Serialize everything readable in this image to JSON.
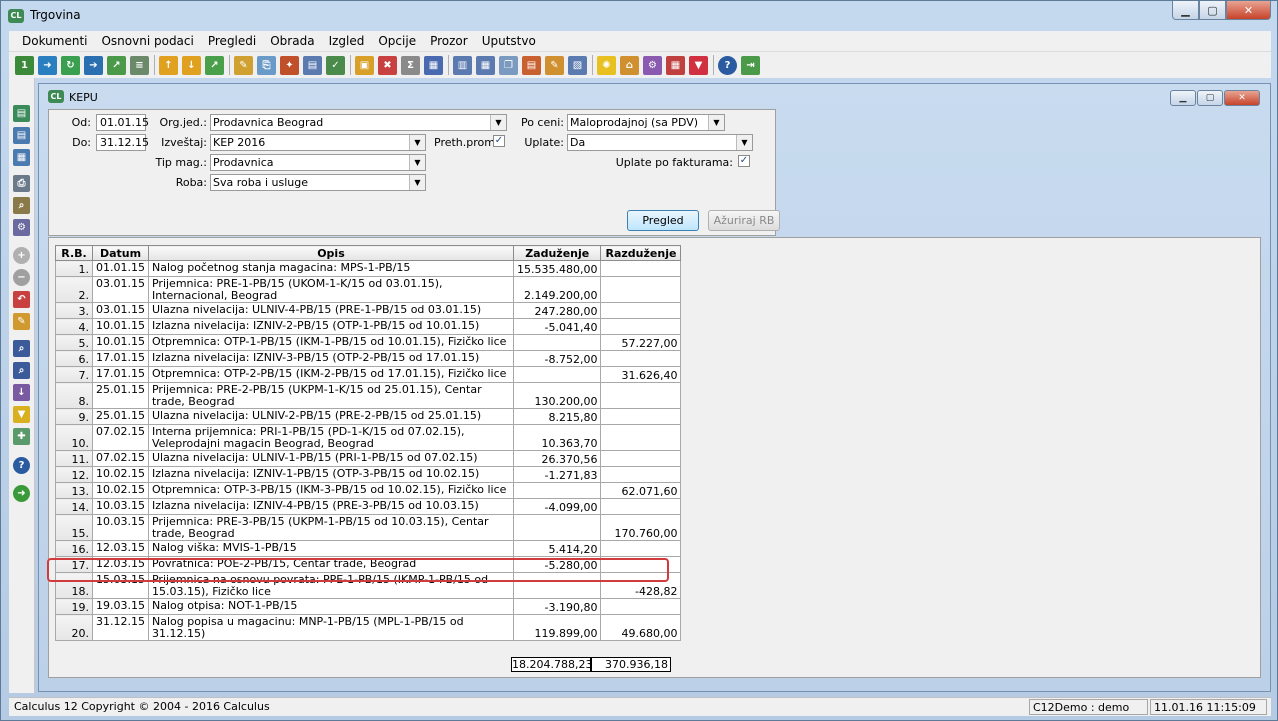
{
  "window": {
    "title": "Trgovina",
    "icon_text": "CL"
  },
  "menu": [
    "Dokumenti",
    "Osnovni podaci",
    "Pregledi",
    "Obrada",
    "Izgled",
    "Opcije",
    "Prozor",
    "Uputstvo"
  ],
  "child_window": {
    "title": "KEPU"
  },
  "filters": {
    "od_label": "Od:",
    "od_value": "01.01.15",
    "do_label": "Do:",
    "do_value": "31.12.15",
    "orgjed_label": "Org.jed.:",
    "orgjed_value": "Prodavnica Beograd",
    "izvestaj_label": "Izveštaj:",
    "izvestaj_value": "KEP 2016",
    "tipmag_label": "Tip mag.:",
    "tipmag_value": "Prodavnica",
    "roba_label": "Roba:",
    "roba_value": "Sva roba i usluge",
    "prethprom_label": "Preth.prom",
    "prethprom_checked": true,
    "poceni_label": "Po ceni:",
    "poceni_value": "Maloprodajnoj (sa PDV)",
    "uplate_label": "Uplate:",
    "uplate_value": "Da",
    "uplatepofak_label": "Uplate po fakturama:",
    "uplatepofak_checked": true,
    "pregled_button": "Pregled",
    "azuriraj_button": "Ažuriraj RB"
  },
  "table": {
    "columns": [
      "R.B.",
      "Datum",
      "Opis",
      "Zaduženje",
      "Razduženje"
    ],
    "rows": [
      {
        "rb": "1.",
        "datum": "01.01.15",
        "opis": "Nalog početnog stanja magacina: MPS-1-PB/15",
        "zad": "15.535.480,00",
        "raz": ""
      },
      {
        "rb": "2.",
        "datum": "03.01.15",
        "opis": "Prijemnica: PRE-1-PB/15 (UKOM-1-K/15 od 03.01.15), Internacional, Beograd",
        "zad": "2.149.200,00",
        "raz": ""
      },
      {
        "rb": "3.",
        "datum": "03.01.15",
        "opis": "Ulazna nivelacija: ULNIV-4-PB/15 (PRE-1-PB/15 od 03.01.15)",
        "zad": "247.280,00",
        "raz": ""
      },
      {
        "rb": "4.",
        "datum": "10.01.15",
        "opis": "Izlazna nivelacija: IZNIV-2-PB/15 (OTP-1-PB/15 od 10.01.15)",
        "zad": "-5.041,40",
        "raz": ""
      },
      {
        "rb": "5.",
        "datum": "10.01.15",
        "opis": "Otpremnica: OTP-1-PB/15 (IKM-1-PB/15 od 10.01.15), Fizičko lice",
        "zad": "",
        "raz": "57.227,00"
      },
      {
        "rb": "6.",
        "datum": "17.01.15",
        "opis": "Izlazna nivelacija: IZNIV-3-PB/15 (OTP-2-PB/15 od 17.01.15)",
        "zad": "-8.752,00",
        "raz": ""
      },
      {
        "rb": "7.",
        "datum": "17.01.15",
        "opis": "Otpremnica: OTP-2-PB/15 (IKM-2-PB/15 od 17.01.15), Fizičko lice",
        "zad": "",
        "raz": "31.626,40"
      },
      {
        "rb": "8.",
        "datum": "25.01.15",
        "opis": "Prijemnica: PRE-2-PB/15 (UKPM-1-K/15 od 25.01.15), Centar trade, Beograd",
        "zad": "130.200,00",
        "raz": ""
      },
      {
        "rb": "9.",
        "datum": "25.01.15",
        "opis": "Ulazna nivelacija: ULNIV-2-PB/15 (PRE-2-PB/15 od 25.01.15)",
        "zad": "8.215,80",
        "raz": ""
      },
      {
        "rb": "10.",
        "datum": "07.02.15",
        "opis": "Interna prijemnica: PRI-1-PB/15 (PD-1-K/15 od 07.02.15), Veleprodajni magacin Beograd, Beograd",
        "zad": "10.363,70",
        "raz": ""
      },
      {
        "rb": "11.",
        "datum": "07.02.15",
        "opis": "Ulazna nivelacija: ULNIV-1-PB/15 (PRI-1-PB/15 od 07.02.15)",
        "zad": "26.370,56",
        "raz": ""
      },
      {
        "rb": "12.",
        "datum": "10.02.15",
        "opis": "Izlazna nivelacija: IZNIV-1-PB/15 (OTP-3-PB/15 od 10.02.15)",
        "zad": "-1.271,83",
        "raz": ""
      },
      {
        "rb": "13.",
        "datum": "10.02.15",
        "opis": "Otpremnica: OTP-3-PB/15 (IKM-3-PB/15 od 10.02.15), Fizičko lice",
        "zad": "",
        "raz": "62.071,60"
      },
      {
        "rb": "14.",
        "datum": "10.03.15",
        "opis": "Izlazna nivelacija: IZNIV-4-PB/15 (PRE-3-PB/15 od 10.03.15)",
        "zad": "-4.099,00",
        "raz": ""
      },
      {
        "rb": "15.",
        "datum": "10.03.15",
        "opis": "Prijemnica: PRE-3-PB/15 (UKPM-1-PB/15 od 10.03.15), Centar trade, Beograd",
        "zad": "",
        "raz": "170.760,00"
      },
      {
        "rb": "16.",
        "datum": "12.03.15",
        "opis": "Nalog viška: MVIS-1-PB/15",
        "zad": "5.414,20",
        "raz": ""
      },
      {
        "rb": "17.",
        "datum": "12.03.15",
        "opis": "Povratnica: POE-2-PB/15, Centar trade, Beograd",
        "zad": "-5.280,00",
        "raz": ""
      },
      {
        "rb": "18.",
        "datum": "15.03.15",
        "opis": "Prijemnica na osnovu povrata: PPE-1-PB/15 (IKMP-1-PB/15 od 15.03.15), Fizičko lice",
        "zad": "",
        "raz": "-428,82"
      },
      {
        "rb": "19.",
        "datum": "19.03.15",
        "opis": "Nalog otpisa: NOT-1-PB/15",
        "zad": "-3.190,80",
        "raz": ""
      },
      {
        "rb": "20.",
        "datum": "31.12.15",
        "opis": "Nalog popisa u magacinu: MNP-1-PB/15 (MPL-1-PB/15 od 31.12.15)",
        "zad": "119.899,00",
        "raz": "49.680,00"
      }
    ],
    "total_zad": "18.204.788,23",
    "total_raz": "370.936,18"
  },
  "status": {
    "copyright": "Calculus 12  Copyright © 2004 - 2016  Calculus",
    "user": "C12Demo : demo",
    "datetime": "11.01.16 11:15:09"
  },
  "colors": {
    "highlight": "#d23b3b",
    "title_bg": "#b5cbe3"
  }
}
